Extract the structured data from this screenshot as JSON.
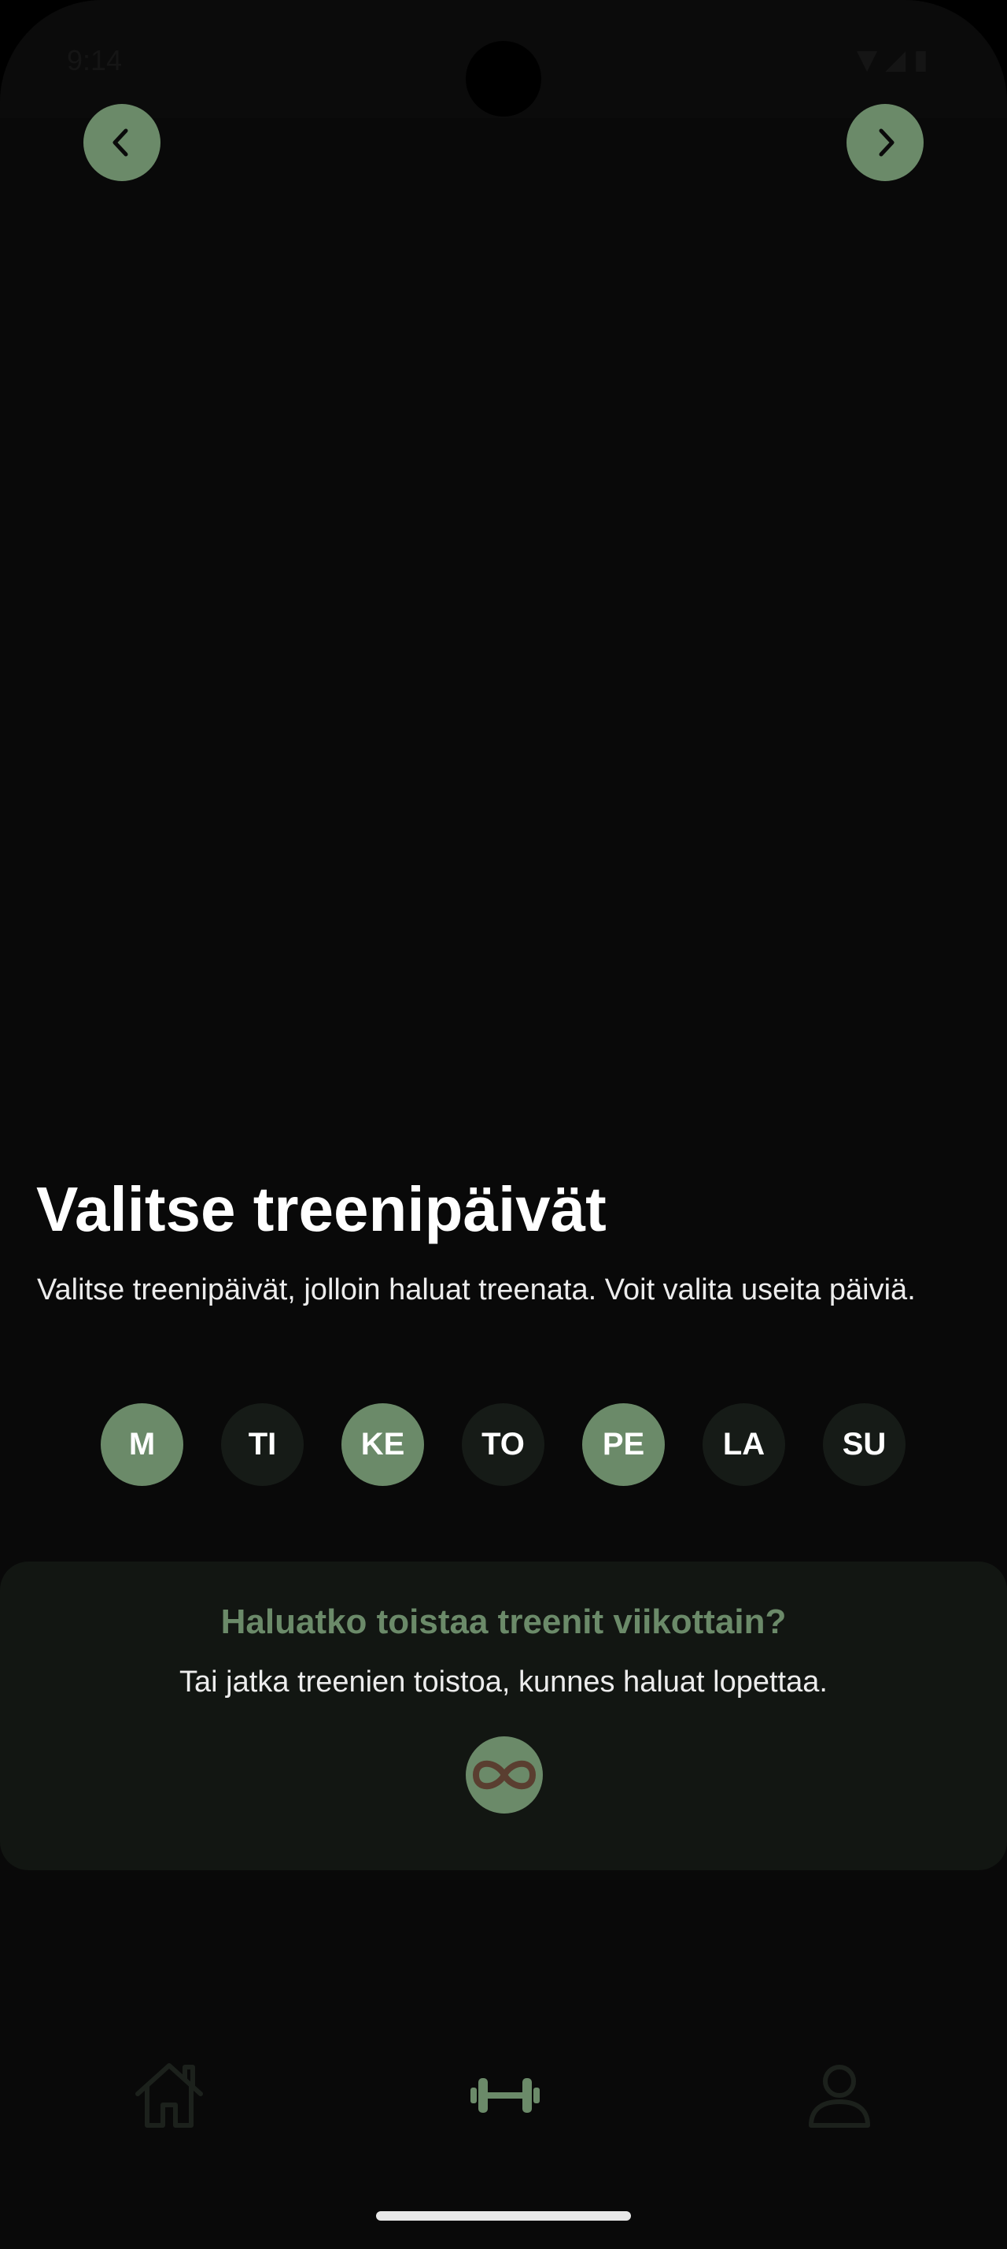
{
  "status_bar": {
    "time": "9:14",
    "icons": [
      "wifi-icon",
      "signal-icon",
      "battery-icon"
    ]
  },
  "nav": {
    "back_icon": "chevron-left-icon",
    "next_icon": "chevron-right-icon"
  },
  "page": {
    "title": "Valitse treenipäivät",
    "subtitle": "Valitse treenipäivät, jolloin haluat treenata. Voit valita useita päiviä."
  },
  "days": [
    {
      "label": "M",
      "selected": true
    },
    {
      "label": "TI",
      "selected": false
    },
    {
      "label": "KE",
      "selected": true
    },
    {
      "label": "TO",
      "selected": false
    },
    {
      "label": "PE",
      "selected": true
    },
    {
      "label": "LA",
      "selected": false
    },
    {
      "label": "SU",
      "selected": false
    }
  ],
  "repeat": {
    "title": "Haluatko toistaa treenit viikottain?",
    "text": "Tai jatka treenien toistoa, kunnes haluat lopettaa.",
    "icon": "infinity-icon"
  },
  "bottom_nav": {
    "items": [
      {
        "icon": "home-icon",
        "active": false
      },
      {
        "icon": "dumbbell-icon",
        "active": true
      },
      {
        "icon": "profile-icon",
        "active": false
      }
    ]
  },
  "colors": {
    "accent": "#6b8a69",
    "background": "#090909",
    "card": "#121612",
    "day_unselected": "#161b17",
    "infinity": "#5a3e30"
  }
}
